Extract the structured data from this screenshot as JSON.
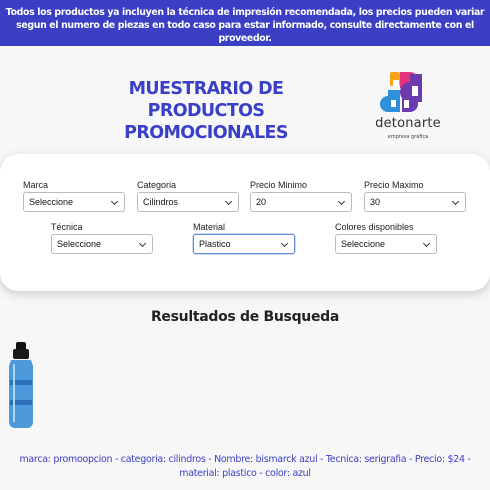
{
  "banner": {
    "text": "Todos los productos ya incluyen la técnica de impresión recomendada, los precios pueden variar segun el numero de piezas en todo caso para estar informado, consulte directamente con el proveedor."
  },
  "header": {
    "title": "MUESTRARIO DE PRODUCTOS PROMOCIONALES",
    "logo_word": "detonarte",
    "logo_sub": "empresa gráfica"
  },
  "filters": {
    "marca": {
      "label": "Marca",
      "value": "Seleccione"
    },
    "categoria": {
      "label": "Categoria",
      "value": "Cilindros"
    },
    "precio_min": {
      "label": "Precio Minimo",
      "value": "20"
    },
    "precio_max": {
      "label": "Precio Maximo",
      "value": "30"
    },
    "tecnica": {
      "label": "Técnica",
      "value": "Seleccione"
    },
    "material": {
      "label": "Material",
      "value": "Plastico"
    },
    "colores": {
      "label": "Colores disponibles",
      "value": "Seleccione"
    }
  },
  "results": {
    "title": "Resultados de Busqueda",
    "items": [
      {
        "description": "marca: promoopcion - categoria: cilindros - Nombre: bismarck azul - Tecnica: serigrafia - Precio: $24 - material: plastico - color: azul"
      }
    ]
  },
  "colors": {
    "banner_bg": "#3b3fc4",
    "title": "#3a3fc8",
    "description": "#3b3fc4"
  }
}
